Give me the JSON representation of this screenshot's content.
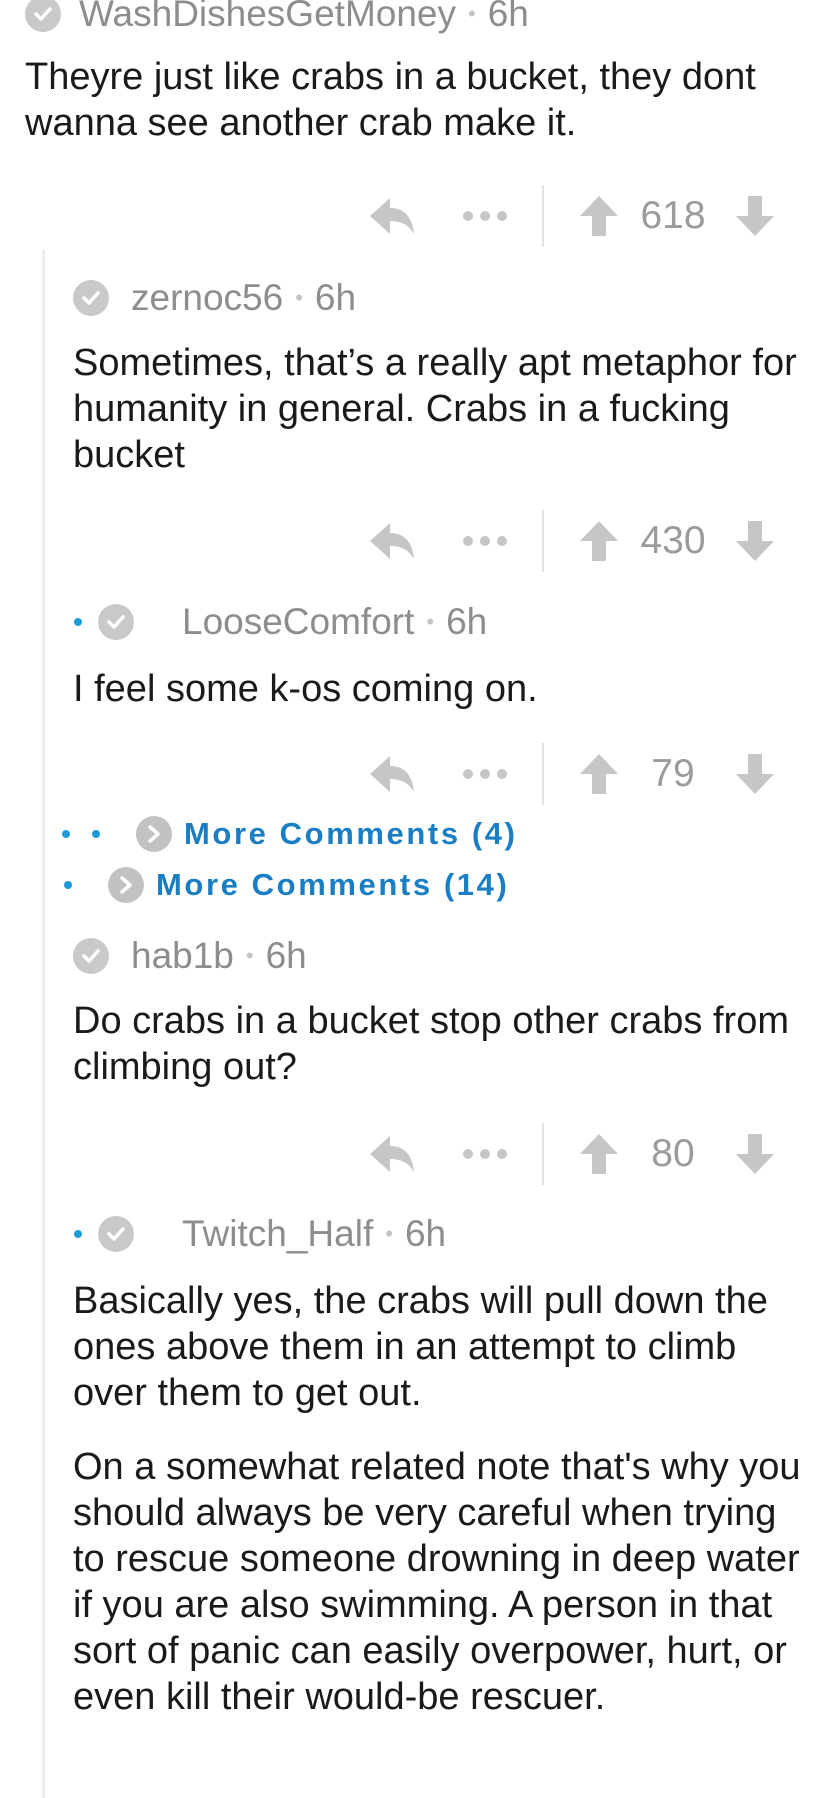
{
  "comments": [
    {
      "username": "WashDishesGetMoney",
      "time": "6h",
      "body": [
        "Theyre just like crabs in a bucket, they dont wanna see another crab make it."
      ],
      "score": "618"
    },
    {
      "username": "zernoc56",
      "time": "6h",
      "body": [
        "Sometimes, that’s a really apt metaphor for humanity in general. Crabs in a fucking bucket"
      ],
      "score": "430"
    },
    {
      "username": "LooseComfort",
      "time": "6h",
      "body": [
        "I feel some k-os coming on."
      ],
      "score": "79"
    },
    {
      "username": "hab1b",
      "time": "6h",
      "body": [
        "Do crabs in a bucket stop other crabs from climbing out?"
      ],
      "score": "80"
    },
    {
      "username": "Twitch_Half",
      "time": "6h",
      "body": [
        "Basically yes, the crabs will pull down the ones above them in an attempt to climb over them to get out.",
        "On a somewhat related note that's why you should always be very careful when trying to rescue someone drowning in deep water if you are also swimming. A person in that sort of panic can easily overpower, hurt, or even kill their would-be rescuer."
      ]
    }
  ],
  "more_comments": [
    {
      "label": "More Comments (4)"
    },
    {
      "label": "More Comments (14)"
    }
  ],
  "icons": {
    "reply": "reply-icon",
    "more": "more-options-icon",
    "upvote": "upvote-icon",
    "downvote": "downvote-icon",
    "check": "check-circle-icon",
    "chevron": "chevron-right-icon"
  },
  "colors": {
    "link": "#1a7ec4",
    "depth_dot": "#1f9ad6",
    "meta": "#8d8d8d",
    "icon": "#c6c6c6"
  }
}
